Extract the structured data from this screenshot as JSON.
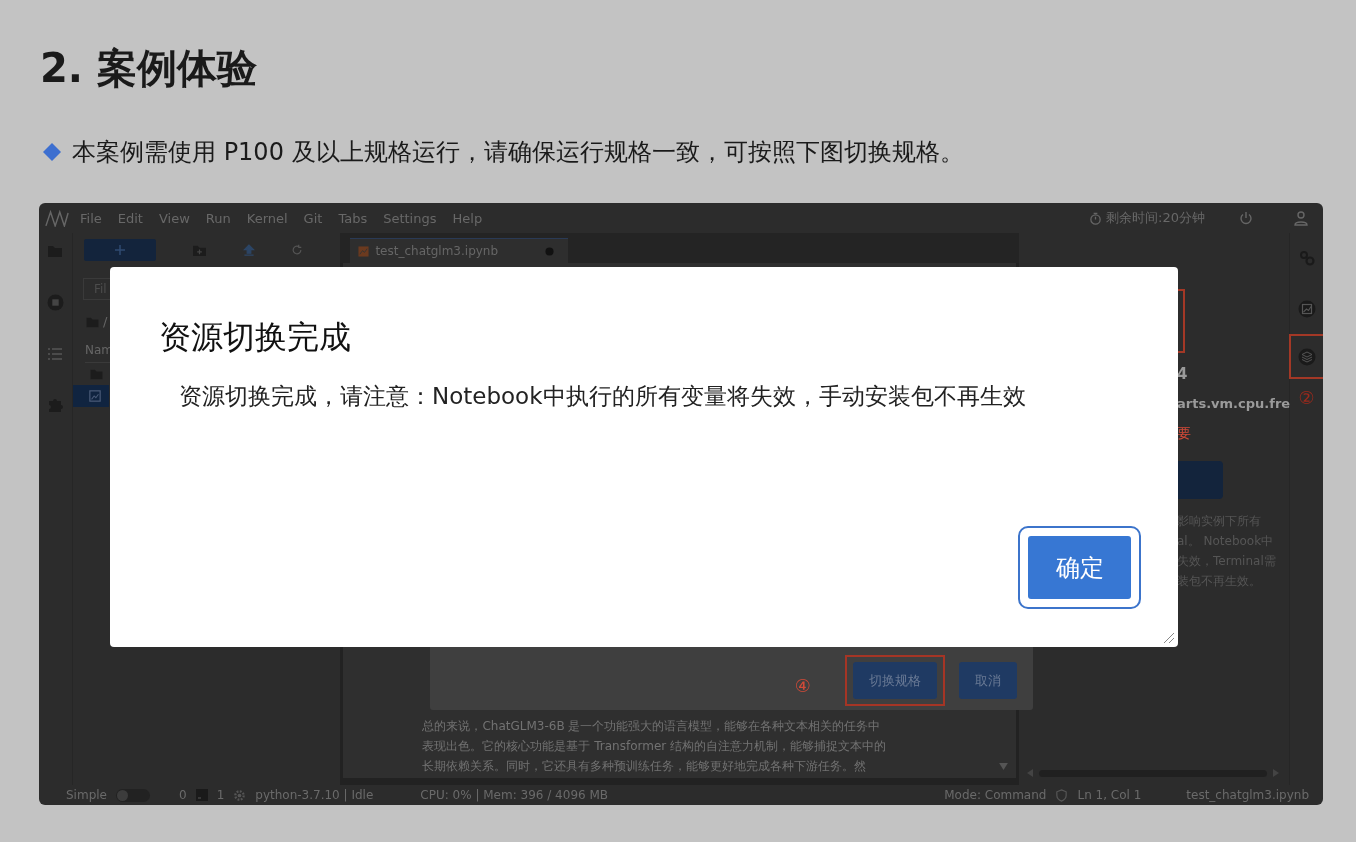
{
  "heading": "2. 案例体验",
  "note": {
    "text": "本案例需使用 P100 及以上规格运行，请确保运行规格一致，可按照下图切换规格。"
  },
  "screenshot": {
    "menu": [
      "File",
      "Edit",
      "View",
      "Run",
      "Kernel",
      "Git",
      "Tabs",
      "Settings",
      "Help"
    ],
    "timer": "剩余时间:20分钟",
    "file_browser": {
      "filter_placeholder": "Fil",
      "path": "/",
      "column": "Nam",
      "rows": [
        {
          "kind": "folder",
          "selected": false
        },
        {
          "kind": "notebook",
          "selected": true
        }
      ]
    },
    "notebook_tab": {
      "title": "test_chatglm3.ipynb"
    },
    "notebook_lines": [
      "总的来说，ChatGLM3-6B 是一个功能强大的语言模型，能够在各种文本相关的任务中",
      "表现出色。它的核心功能是基于 Transformer 结构的自注意力机制，能够捕捉文本中的",
      "长期依赖关系。同时，它还具有多种预训练任务，能够更好地完成各种下游任务。然"
    ],
    "spec_dialog": {
      "step_mark": "④",
      "buttons": [
        {
          "label": "切换规格",
          "highlighted": true
        },
        {
          "label": "取消",
          "highlighted": false
        }
      ]
    },
    "right_panel": {
      "value": "4",
      "flavor": "arts.vm.cpu.fre",
      "price_note": "要",
      "notice_lines": [
        "影响实例下所有",
        "al。 Notebook中",
        "失效，Terminal需",
        "装包不再生效。"
      ]
    },
    "right_sidebar": {
      "step_mark": "②"
    },
    "status_bar": {
      "mode_label": "Simple",
      "simple_on": false,
      "terminals": "0",
      "kernels": "1",
      "kernel": "python-3.7.10 | Idle",
      "resources": "CPU: 0% | Mem: 396 / 4096 MB",
      "mode": "Mode: Command",
      "cursor": "Ln 1, Col 1",
      "file": "test_chatglm3.ipynb"
    }
  },
  "modal": {
    "title": "资源切换完成",
    "message": "资源切换完成，请注意：Notebook中执行的所有变量将失效，手动安装包不再生效",
    "ok_button": "确定"
  }
}
